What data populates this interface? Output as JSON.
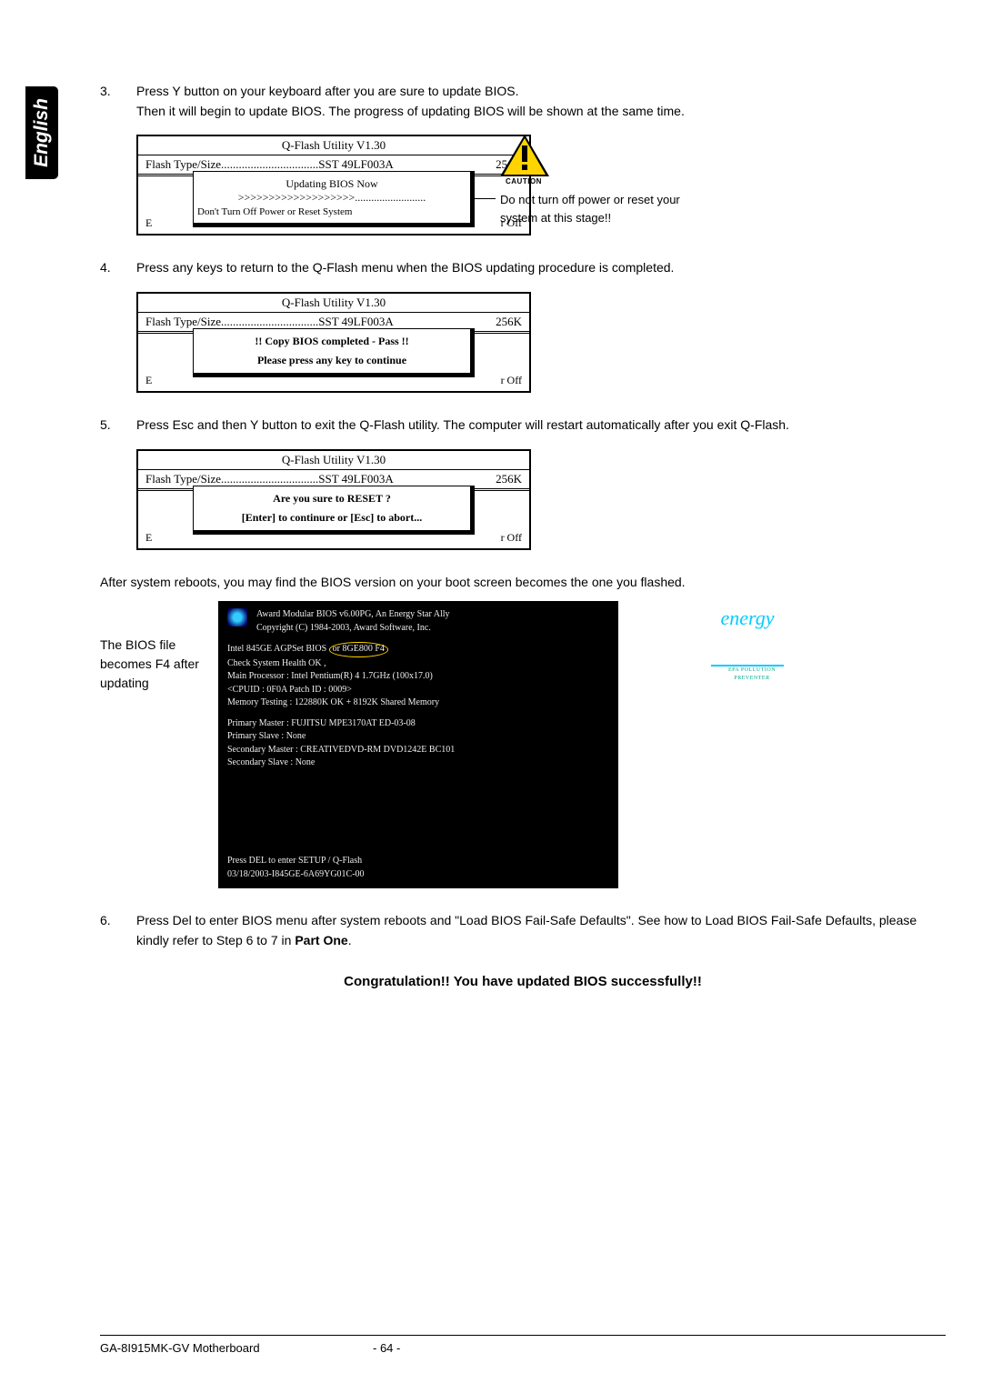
{
  "side_tab": "English",
  "steps": {
    "s3": {
      "num": "3.",
      "line1": "Press Y button on your keyboard after you are sure to update BIOS.",
      "line2": "Then it will begin to update BIOS. The progress of updating BIOS will be shown at the same time."
    },
    "s4": {
      "num": "4.",
      "line1": "Press any keys to return to the Q-Flash menu when the BIOS updating procedure is completed."
    },
    "s5": {
      "num": "5.",
      "line1": "Press Esc and then Y button to exit the Q-Flash utility. The computer will restart automatically after you exit Q-Flash."
    },
    "s6": {
      "num": "6.",
      "line1": "Press Del to enter BIOS menu after system reboots and \"Load BIOS Fail-Safe Defaults\". See how to Load BIOS Fail-Safe Defaults, please kindly refer to Step 6 to 7 in ",
      "bold": "Part One",
      "tail": "."
    }
  },
  "qflash": {
    "title": "Q-Flash Utility V1.30",
    "type_label": "Flash Type/Size.................................SST 49LF003A",
    "size": "256K",
    "below_left": "E",
    "below_right": "r Off",
    "box1": {
      "inner1": "Updating BIOS Now",
      "inner2": ">>>>>>>>>>>>>>>>>>>..........................",
      "bottom_hint": "Don't Turn Off Power or Reset System"
    },
    "box2": {
      "inner1": "!! Copy BIOS completed - Pass !!",
      "inner2": "Please press any key to continue"
    },
    "box3": {
      "inner1": "Are you sure to RESET ?",
      "inner2": "[Enter] to continure or [Esc] to abort..."
    }
  },
  "caution": {
    "label": "CAUTION",
    "text": "Do not turn off power or reset your system at this stage!!"
  },
  "after_reboot": "After system reboots, you may find the BIOS version on your boot screen becomes the one you flashed.",
  "boot_label": "The BIOS file becomes F4 after updating",
  "boot": {
    "hdr1": "Award Modular BIOS v6.00PG, An Energy Star Ally",
    "hdr2": "Copyright (C) 1984-2003, Award Software, Inc.",
    "line1a": "Intel 845GE AGPSet BIOS ",
    "line1b": "or 8GE800 F4",
    "line2": "Check System Health OK ,",
    "line3": "Main Processor : Intel Pentium(R) 4  1.7GHz (100x17.0)",
    "line4": "<CPUID : 0F0A Patch ID : 0009>",
    "line5": "Memory Testing  : 122880K OK + 8192K Shared Memory",
    "line6": "Primary Master : FUJITSU MPE3170AT ED-03-08",
    "line7": "Primary Slave : None",
    "line8": "Secondary Master : CREATIVEDVD-RM DVD1242E BC101",
    "line9": "Secondary Slave : None",
    "foot1": "Press DEL to enter SETUP / Q-Flash",
    "foot2": "03/18/2003-I845GE-6A69YG01C-00"
  },
  "energy": {
    "logo": "energy",
    "sub": "EPA  POLLUTION PREVENTER"
  },
  "congrat": "Congratulation!! You have updated BIOS successfully!!",
  "footer": {
    "model": "GA-8I915MK-GV Motherboard",
    "page": "- 64 -"
  }
}
